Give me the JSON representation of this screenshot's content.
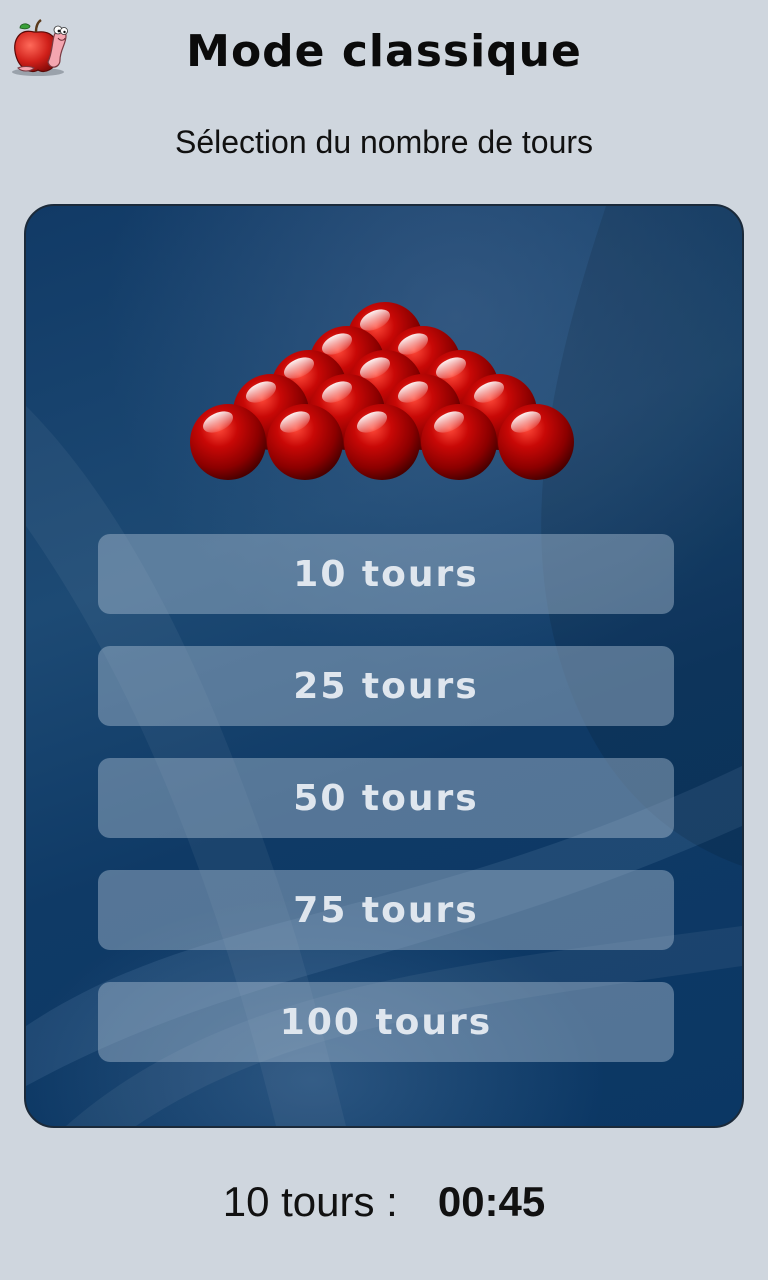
{
  "header": {
    "title": "Mode classique",
    "subtitle": "Sélection du nombre de tours",
    "logo_icon": "apple-worm-icon"
  },
  "graphic": {
    "icon": "snooker-balls-triangle",
    "ball_color": "#b00000"
  },
  "menu": {
    "options": [
      {
        "label": "10 tours"
      },
      {
        "label": "25 tours"
      },
      {
        "label": "50 tours"
      },
      {
        "label": "75 tours"
      },
      {
        "label": "100 tours"
      }
    ]
  },
  "footer": {
    "label": "10 tours :",
    "time": "00:45"
  },
  "colors": {
    "background": "#cfd6de",
    "panel": "#123c6a",
    "button_text": "#dfe6ee"
  }
}
